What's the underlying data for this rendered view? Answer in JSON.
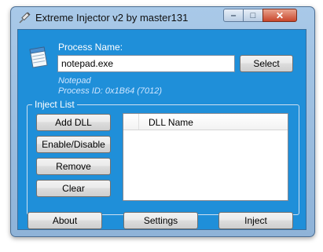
{
  "window": {
    "title": "Extreme Injector v2 by master131",
    "controls": {
      "minimize": "‒",
      "maximize": "□",
      "close": "✕"
    }
  },
  "process": {
    "label": "Process Name:",
    "input_value": "notepad.exe",
    "select_label": "Select",
    "name_info": "Notepad",
    "pid_info": "Process ID: 0x1B64 (7012)"
  },
  "inject_list": {
    "legend": "Inject List",
    "buttons": {
      "add": "Add DLL",
      "toggle": "Enable/Disable",
      "remove": "Remove",
      "clear": "Clear"
    },
    "columns": [
      "",
      "DLL Name"
    ],
    "rows": []
  },
  "footer": {
    "about": "About",
    "settings": "Settings",
    "inject": "Inject"
  },
  "colors": {
    "client_bg": "#1f8fd9",
    "frame": "#a9c9e8",
    "info_text": "#cfe6ff"
  },
  "icons": {
    "app": "syringe-icon",
    "process": "notepad-icon"
  }
}
